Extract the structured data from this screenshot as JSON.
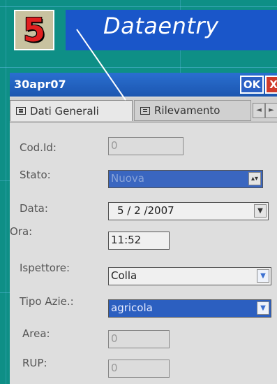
{
  "slide": {
    "number": "5",
    "title": "Dataentry"
  },
  "window": {
    "title": "30apr07",
    "ok_label": "OK",
    "close_label": "X"
  },
  "tabs": [
    {
      "label": "Dati Generali",
      "icon": "form-icon",
      "active": true
    },
    {
      "label": "Rilevamento",
      "icon": "form-icon",
      "active": false
    }
  ],
  "tab_scroll": {
    "left": "◄",
    "right": "►"
  },
  "form": {
    "cod_id": {
      "label": "Cod.Id:",
      "value": "0"
    },
    "stato": {
      "label": "Stato:",
      "value": "Nuova"
    },
    "data": {
      "label": "Data:",
      "value": "5 / 2 /2007"
    },
    "ora": {
      "label": "Ora:",
      "value": "11:52"
    },
    "ispettore": {
      "label": "Ispettore:",
      "value": "Colla"
    },
    "tipo_azie": {
      "label": "Tipo Azie.:",
      "value": "agricola"
    },
    "area": {
      "label": "Area:",
      "value": "0"
    },
    "rup": {
      "label": "RUP:",
      "value": "0"
    }
  },
  "colors": {
    "slide_bg": "#0e8f86",
    "title_bar": "#1a56c9",
    "slide_number": "#e02020",
    "device_titlebar": "#1c56b0"
  }
}
